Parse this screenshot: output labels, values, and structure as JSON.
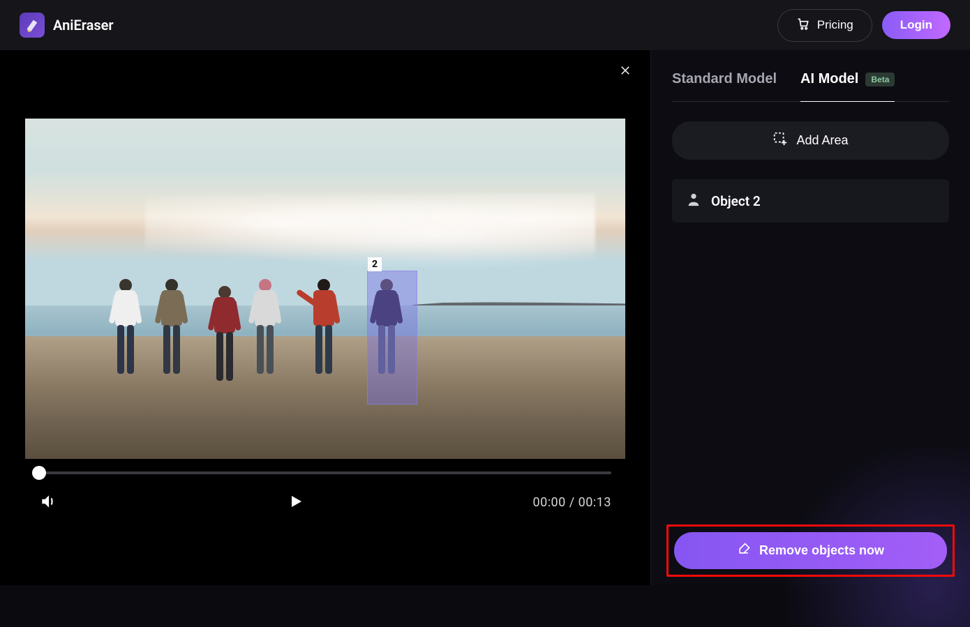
{
  "header": {
    "app_name": "AniEraser",
    "pricing_label": "Pricing",
    "login_label": "Login"
  },
  "editor": {
    "selection_number": "2",
    "time_current": "00:00",
    "time_total": "00:13",
    "time_separator": " / "
  },
  "sidebar": {
    "tabs": {
      "standard": "Standard Model",
      "ai": "AI Model",
      "beta_label": "Beta"
    },
    "add_area_label": "Add Area",
    "object_label": "Object 2",
    "remove_label": "Remove objects now"
  },
  "colors": {
    "brand_gradient_start": "#8a5cf6",
    "brand_gradient_end": "#c169ff",
    "highlight_red": "#f40a0a"
  }
}
